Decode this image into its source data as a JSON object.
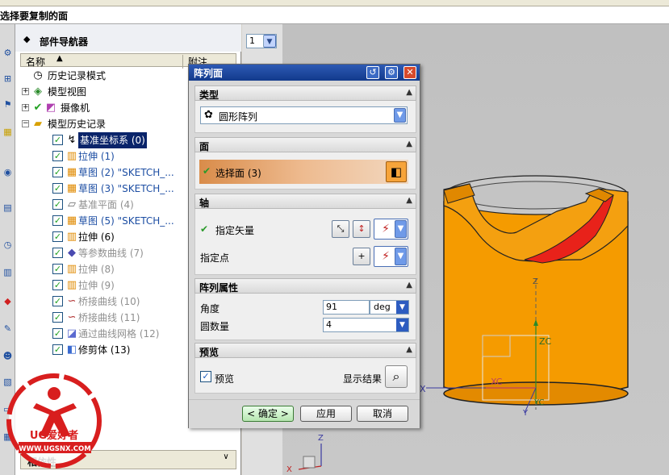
{
  "status_prompt": "选择要复制的面",
  "navigator": {
    "title": "部件导航器",
    "col_name": "名称",
    "col_note": "附注",
    "items": [
      {
        "label": "历史记录模式",
        "num": ""
      },
      {
        "label": "模型视图",
        "num": ""
      },
      {
        "label": "摄像机",
        "num": ""
      },
      {
        "label": "模型历史记录",
        "num": ""
      },
      {
        "label": "基准坐标系",
        "num": "(0)"
      },
      {
        "label": "拉伸",
        "num": "(1)"
      },
      {
        "label": "草图 (2) \"SKETCH_...",
        "num": ""
      },
      {
        "label": "草图 (3) \"SKETCH_...",
        "num": ""
      },
      {
        "label": "基准平面",
        "num": "(4)"
      },
      {
        "label": "草图 (5) \"SKETCH_...",
        "num": ""
      },
      {
        "label": "拉伸",
        "num": "(6)"
      },
      {
        "label": "等参数曲线",
        "num": "(7)"
      },
      {
        "label": "拉伸",
        "num": "(8)"
      },
      {
        "label": "拉伸",
        "num": "(9)"
      },
      {
        "label": "桥接曲线",
        "num": "(10)"
      },
      {
        "label": "桥接曲线",
        "num": "(11)"
      },
      {
        "label": "通过曲线网格",
        "num": "(12)"
      },
      {
        "label": "修剪体",
        "num": "(13)"
      }
    ],
    "bottom_panel": "相依性"
  },
  "layer_value": "1",
  "dialog": {
    "title": "阵列面",
    "type_section": "类型",
    "type_value": "圆形阵列",
    "face_section": "面",
    "select_face": "选择面 (3)",
    "axis_section": "轴",
    "specify_vector": "指定矢量",
    "specify_point": "指定点",
    "props_section": "阵列属性",
    "angle_label": "角度",
    "angle_value": "91",
    "angle_unit": "deg",
    "count_label": "圆数量",
    "count_value": "4",
    "preview_section": "预览",
    "preview_label": "预览",
    "preview_checked": true,
    "show_result": "显示结果",
    "ok": "< 确定 >",
    "apply": "应用",
    "cancel": "取消"
  },
  "viewport": {
    "axis_labels": {
      "z": "Z",
      "zc": "ZC",
      "xc": "XC",
      "x": "X",
      "yc": "YC",
      "y": "Y"
    },
    "triad_labels": {
      "z": "Z",
      "x": "X"
    }
  },
  "watermark": {
    "brand": "UG爱好者",
    "url": "WWW.UGSNX.COM"
  },
  "colors": {
    "title_bar": "#1f4aa0",
    "part_orange": "#f59b00",
    "highlight_red": "#e02020",
    "selection_blue": "#0a246a"
  }
}
